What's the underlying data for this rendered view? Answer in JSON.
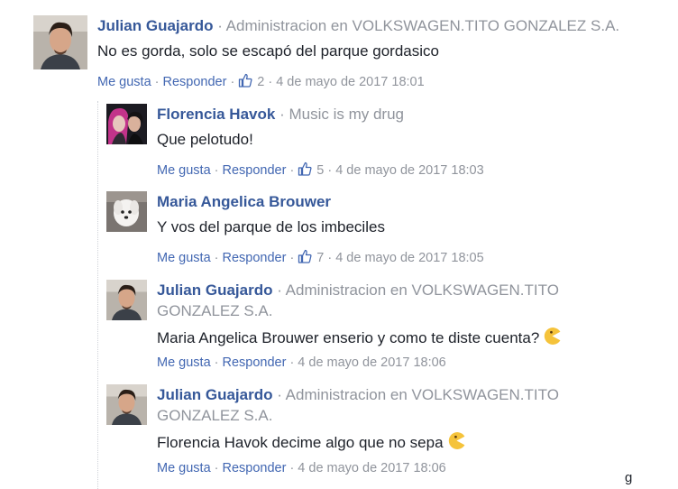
{
  "comments": [
    {
      "author": "Julian Guajardo",
      "work": "Administracion en VOLKSWAGEN.TITO GONZALEZ S.A.",
      "text": "No es gorda, solo se escapó del parque gordasico",
      "like": "Me gusta",
      "reply": "Responder",
      "likes": "2",
      "time": "4 de mayo de 2017 18:01"
    },
    {
      "author": "Florencia Havok",
      "work": "Music is my drug",
      "text": "Que pelotudo!",
      "like": "Me gusta",
      "reply": "Responder",
      "likes": "5",
      "time": "4 de mayo de 2017 18:03"
    },
    {
      "author": "Maria Angelica Brouwer",
      "text": "Y vos del parque de los imbeciles",
      "like": "Me gusta",
      "reply": "Responder",
      "likes": "7",
      "time": "4 de mayo de 2017 18:05"
    },
    {
      "author": "Julian Guajardo",
      "work_line1": "Administracion en VOLKSWAGEN.TITO",
      "work_line2": "GONZALEZ S.A.",
      "text": "Maria Angelica Brouwer enserio y como te diste cuenta?",
      "like": "Me gusta",
      "reply": "Responder",
      "time": "4 de mayo de 2017 18:06"
    },
    {
      "author": "Julian Guajardo",
      "work_line1": "Administracion en VOLKSWAGEN.TITO",
      "work_line2": "GONZALEZ S.A.",
      "text": "Florencia Havok decime algo que no sepa",
      "like": "Me gusta",
      "reply": "Responder",
      "time": "4 de mayo de 2017 18:06"
    }
  ],
  "edge_glyph": "g",
  "icons": {
    "like": "thumbs-up-icon",
    "emoji": "pacman-emoji-icon"
  },
  "colors": {
    "link": "#365899",
    "action": "#4267b2",
    "meta": "#90949c",
    "text": "#1d2129"
  }
}
